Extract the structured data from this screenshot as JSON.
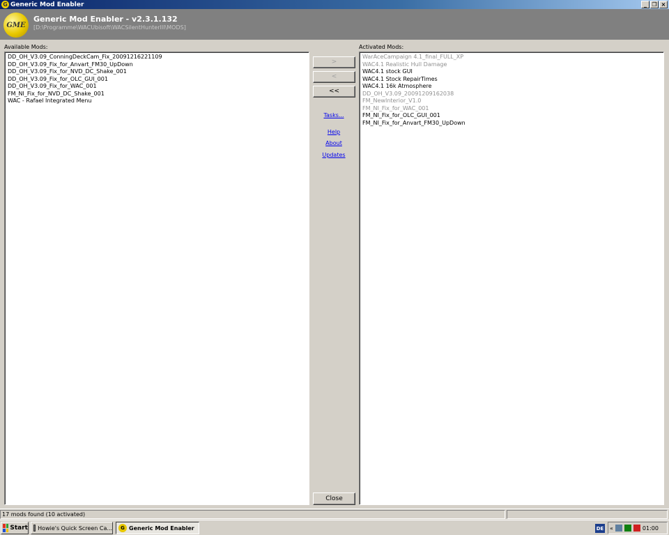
{
  "window": {
    "title": "Generic Mod Enabler",
    "controls": {
      "minimize": "_",
      "restore": "❐",
      "close": "×"
    }
  },
  "header": {
    "logo_text": "GME",
    "app_title": "Generic Mod Enabler - v2.3.1.132",
    "path": "[D:\\Programme\\WACUbisoft\\WACSilentHunterIII\\MODS]"
  },
  "available": {
    "label": "Available Mods:",
    "items": [
      "DD_OH_V3.09_ConningDeckCam_Fix_20091216221109",
      "DD_OH_V3.09_Fix_for_Anvart_FM30_UpDown",
      "DD_OH_V3.09_Fix_for_NVD_DC_Shake_001",
      "DD_OH_V3.09_Fix_for_OLC_GUI_001",
      "DD_OH_V3.09_Fix_for_WAC_001",
      "FM_NI_Fix_for_NVD_DC_Shake_001",
      "WAC - Rafael Integrated Menu"
    ]
  },
  "activated": {
    "label": "Activated Mods:",
    "items": [
      {
        "text": "WarAceCampaign 4.1_final_FULL_XP",
        "dim": true
      },
      {
        "text": "WAC4.1 Realistic Hull Damage",
        "dim": true
      },
      {
        "text": "WAC4.1 stock GUI",
        "dim": false
      },
      {
        "text": "WAC4.1 Stock RepairTimes",
        "dim": false
      },
      {
        "text": "WAC4.1 16k Atmosphere",
        "dim": false
      },
      {
        "text": "DD_OH_V3.09_20091209162038",
        "dim": true
      },
      {
        "text": "FM_NewInterior_V1.0",
        "dim": true
      },
      {
        "text": "FM_NI_Fix_for_WAC_001",
        "dim": true
      },
      {
        "text": "FM_NI_Fix_for_OLC_GUI_001",
        "dim": false
      },
      {
        "text": "FM_NI_Fix_for_Anvart_FM30_UpDown",
        "dim": false
      }
    ]
  },
  "middle": {
    "btn_add": ">",
    "btn_remove": "<",
    "btn_remove_all": "<<",
    "tasks": "Tasks...",
    "help": "Help",
    "about": "About",
    "updates": "Updates",
    "close": "Close"
  },
  "status": {
    "text": "17 mods found (10 activated)"
  },
  "taskbar": {
    "start": "Start",
    "task1": "Howie's Quick Screen Ca...",
    "task2": "Generic Mod Enabler",
    "lang": "DE",
    "chevron": "«",
    "clock": "01:00"
  },
  "colors": {
    "title_gradient_start": "#0a246a",
    "header_bg": "#808080",
    "dim_item": "#909090",
    "link": "#0000ee"
  }
}
